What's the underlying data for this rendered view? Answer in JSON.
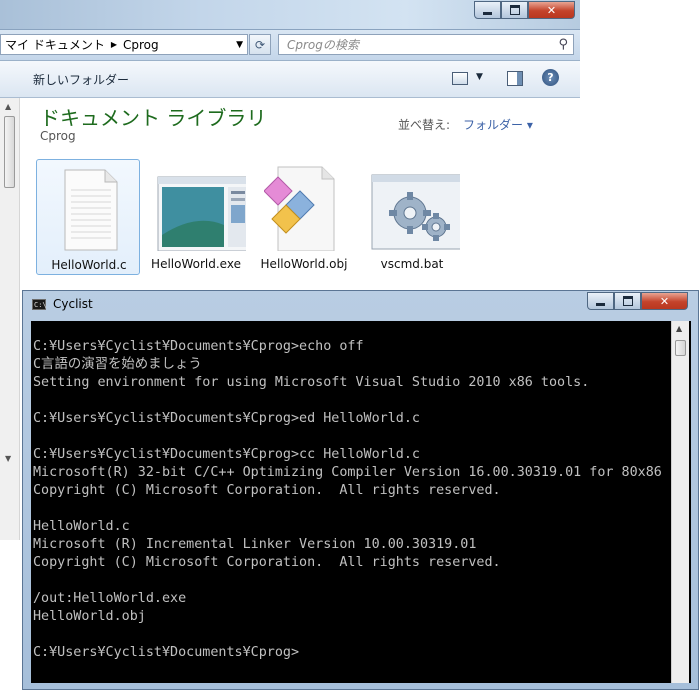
{
  "explorer": {
    "breadcrumb": {
      "root": "マイ ドキュメント",
      "current": "Cprog"
    },
    "search_placeholder": "Cprogの検索",
    "toolbar": {
      "new_folder": "新しいフォルダー"
    },
    "library": {
      "title": "ドキュメント ライブラリ",
      "subtitle": "Cprog"
    },
    "sort": {
      "label": "並べ替え:",
      "value": "フォルダー"
    },
    "files": [
      {
        "name": "HelloWorld.c",
        "icon": "text-file-icon",
        "selected": true
      },
      {
        "name": "HelloWorld.exe",
        "icon": "application-window-icon"
      },
      {
        "name": "HelloWorld.obj",
        "icon": "object-file-icon"
      },
      {
        "name": "vscmd.bat",
        "icon": "gears-batch-icon"
      }
    ]
  },
  "console": {
    "title": "Cyclist",
    "lines": [
      "C:¥Users¥Cyclist¥Documents¥Cprog>echo off",
      "C言語の演習を始めましょう",
      "Setting environment for using Microsoft Visual Studio 2010 x86 tools.",
      "",
      "C:¥Users¥Cyclist¥Documents¥Cprog>ed HelloWorld.c",
      "",
      "C:¥Users¥Cyclist¥Documents¥Cprog>cc HelloWorld.c",
      "Microsoft(R) 32-bit C/C++ Optimizing Compiler Version 16.00.30319.01 for 80x86",
      "Copyright (C) Microsoft Corporation.  All rights reserved.",
      "",
      "HelloWorld.c",
      "Microsoft (R) Incremental Linker Version 10.00.30319.01",
      "Copyright (C) Microsoft Corporation.  All rights reserved.",
      "",
      "/out:HelloWorld.exe",
      "HelloWorld.obj",
      "",
      "C:¥Users¥Cyclist¥Documents¥Cprog>"
    ]
  },
  "colors": {
    "library_title": "#1e6b1e",
    "sort_link": "#3c62a7",
    "console_bg": "#000000",
    "console_fg": "#c0c0c0"
  }
}
